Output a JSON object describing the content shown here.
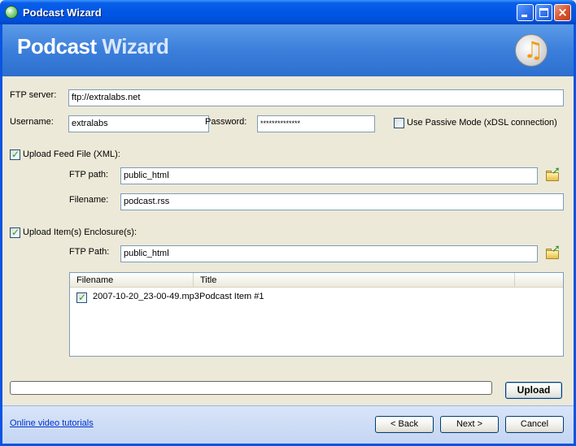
{
  "window": {
    "title": "Podcast Wizard"
  },
  "banner": {
    "title_word1": "Podcast",
    "title_word2": "Wizard"
  },
  "ftp": {
    "server_label": "FTP server:",
    "server_value": "ftp://extralabs.net",
    "username_label": "Username:",
    "username_value": "extralabs",
    "password_label": "Password:",
    "password_value": "**************",
    "passive_label": "Use Passive Mode (xDSL connection)",
    "passive_checked": false
  },
  "feed": {
    "checkbox_label": "Upload Feed File (XML):",
    "checked": true,
    "path_label": "FTP path:",
    "path_value": "public_html",
    "filename_label": "Filename:",
    "filename_value": "podcast.rss"
  },
  "enclosures": {
    "checkbox_label": "Upload Item(s) Enclosure(s):",
    "checked": true,
    "path_label": "FTP Path:",
    "path_value": "public_html",
    "columns": [
      "Filename",
      "Title"
    ],
    "rows": [
      {
        "checked": true,
        "filename": "2007-10-20_23-00-49.mp3",
        "title": "Podcast Item #1"
      }
    ]
  },
  "progress": {
    "value": 0
  },
  "buttons": {
    "upload": "Upload",
    "back": "< Back",
    "next": "Next >",
    "cancel": "Cancel"
  },
  "footer": {
    "link": "Online video tutorials"
  },
  "colors": {
    "titlebar": "#0054E3",
    "banner": "#3B7FDB",
    "dialog_bg": "#ECE9D8",
    "link": "#0033CC"
  },
  "icons": [
    "podcast-app-icon",
    "music-disc-logo",
    "folder-open-icon",
    "checkbox-check-icon"
  ]
}
